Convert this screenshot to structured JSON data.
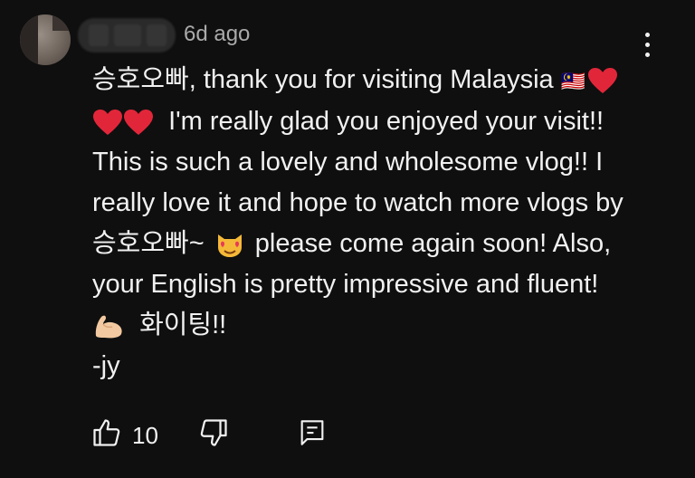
{
  "header": {
    "timestamp": "6d ago"
  },
  "comment": {
    "line1_text": "승호오빠, thank you for visiting Malaysia ",
    "line1_flags": "🇲🇾",
    "line2_text": "I'm really glad you enjoyed your visit!!",
    "line3_text": "This is such a lovely and wholesome vlog!! I",
    "line4_text": "really love it and hope to watch more vlogs by",
    "line5_prefix": "승호오빠~",
    "line5_text": "please come again soon! Also,",
    "line6_text": "your English is pretty impressive and fluent!",
    "line7_text": "화이팅!!",
    "line8_text": "-jy"
  },
  "actions": {
    "like_count": "10"
  },
  "icons": {
    "heart": "red-heart-emoji",
    "cat": "smiling-cat-heart-eyes-emoji",
    "flex": "flexed-biceps-emoji",
    "like": "thumbs-up-icon",
    "dislike": "thumbs-down-icon",
    "reply": "reply-icon",
    "more": "more-vert-icon"
  },
  "colors": {
    "background": "#0f0f0f",
    "text": "#f1f1f1",
    "secondary": "#aaaaaa",
    "heart": "#e2263a"
  }
}
